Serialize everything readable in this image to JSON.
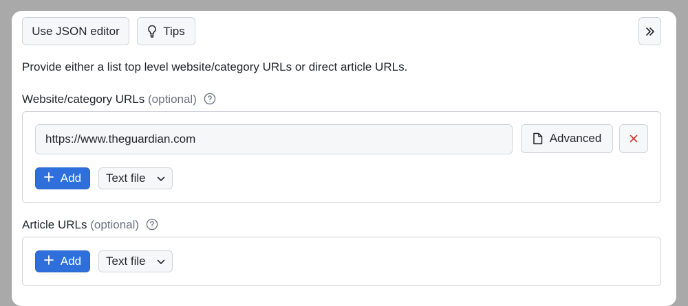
{
  "toolbar": {
    "json_editor_label": "Use JSON editor",
    "tips_label": "Tips",
    "tips_icon": "lightbulb-icon",
    "expand_icon": "double-chevron-right-icon"
  },
  "intro_text": "Provide either a list top level website/category URLs or direct article URLs.",
  "website_urls": {
    "label": "Website/category URLs",
    "optional": "(optional)",
    "help_icon": "question-circle-icon",
    "items": [
      {
        "value": "https://www.theguardian.com",
        "advanced_label": "Advanced",
        "advanced_icon": "file-icon",
        "remove_icon": "close-icon"
      }
    ],
    "add_label": "Add",
    "source_select": "Text file"
  },
  "article_urls": {
    "label": "Article URLs",
    "optional": "(optional)",
    "help_icon": "question-circle-icon",
    "add_label": "Add",
    "source_select": "Text file"
  },
  "colors": {
    "accent": "#2f6fdb",
    "remove": "#d03b2f",
    "background": "#a9a9a9",
    "card": "#ffffff"
  }
}
